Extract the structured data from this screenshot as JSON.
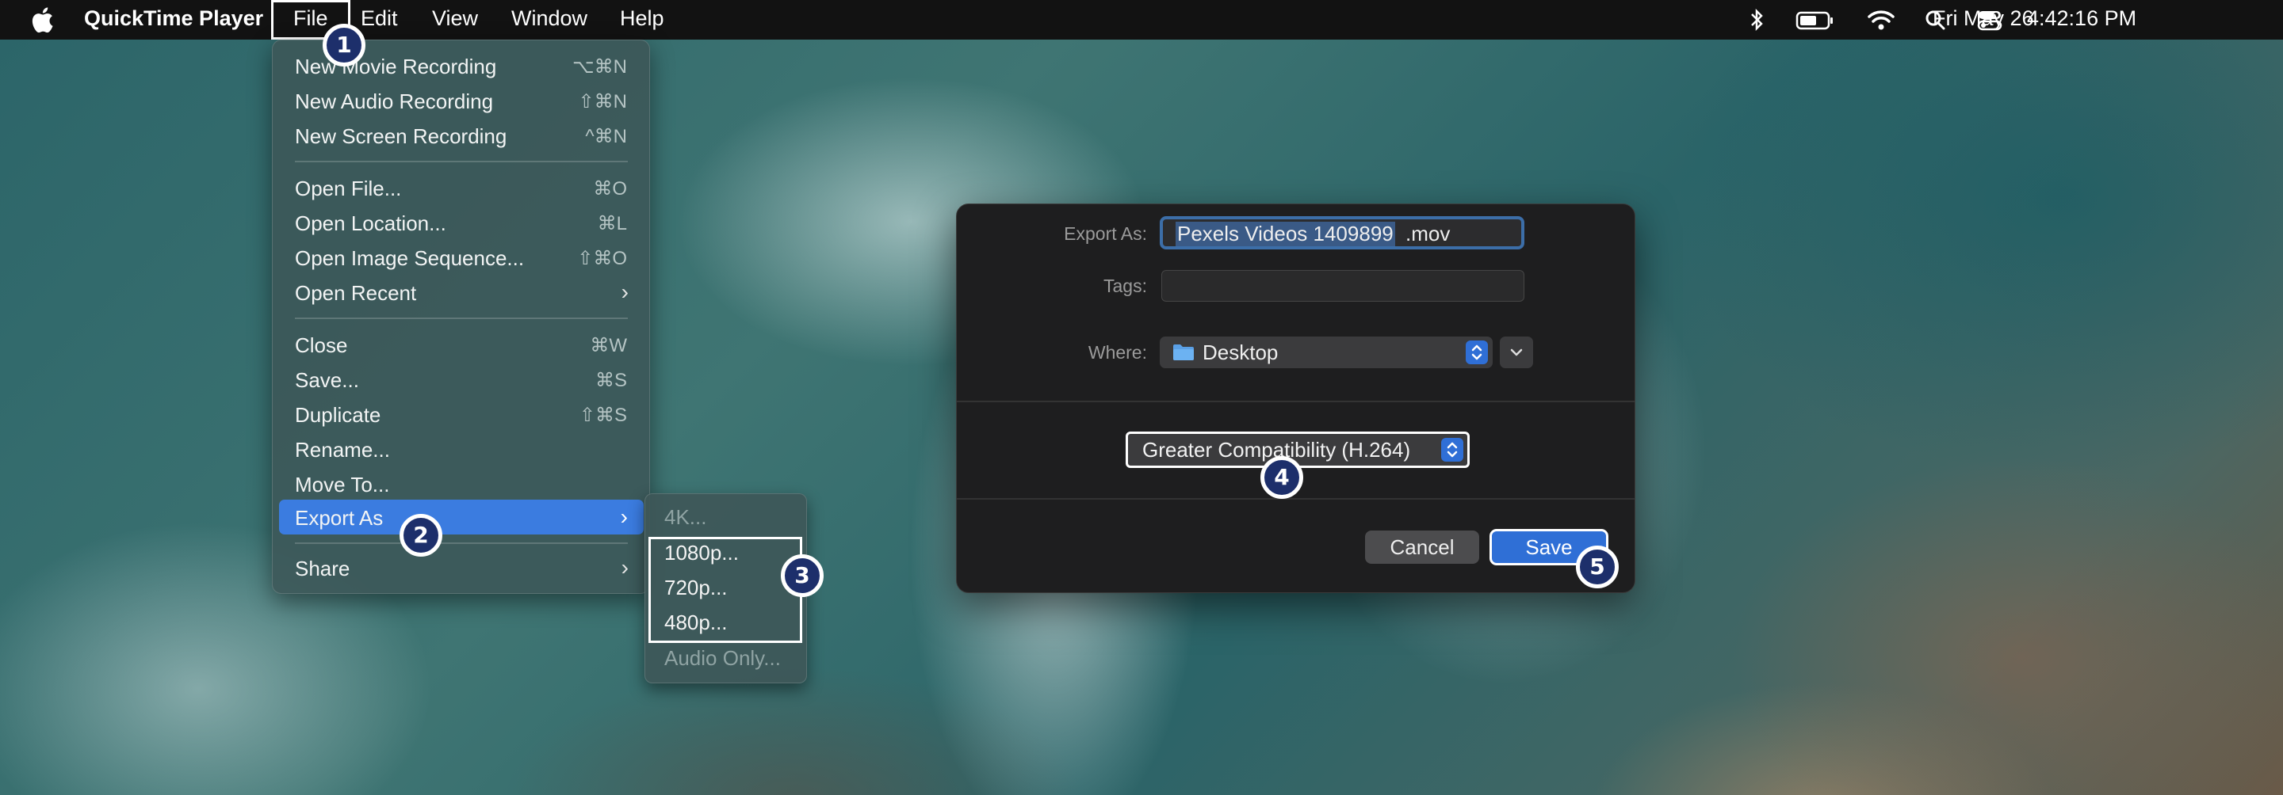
{
  "menubar": {
    "app_name": "QuickTime Player",
    "menus": [
      "File",
      "Edit",
      "View",
      "Window",
      "Help"
    ],
    "date": "Fri May 26",
    "time": "4:42:16 PM"
  },
  "file_menu": {
    "items": [
      {
        "label": "New Movie Recording",
        "shortcut": "⌥⌘N"
      },
      {
        "label": "New Audio Recording",
        "shortcut": "⇧⌘N"
      },
      {
        "label": "New Screen Recording",
        "shortcut": "^⌘N"
      },
      {
        "label": "Open File...",
        "shortcut": "⌘O"
      },
      {
        "label": "Open Location...",
        "shortcut": "⌘L"
      },
      {
        "label": "Open Image Sequence...",
        "shortcut": "⇧⌘O"
      },
      {
        "label": "Open Recent",
        "shortcut": ""
      },
      {
        "label": "Close",
        "shortcut": "⌘W"
      },
      {
        "label": "Save...",
        "shortcut": "⌘S"
      },
      {
        "label": "Duplicate",
        "shortcut": "⇧⌘S"
      },
      {
        "label": "Rename...",
        "shortcut": ""
      },
      {
        "label": "Move To...",
        "shortcut": ""
      },
      {
        "label": "Export As",
        "shortcut": ""
      },
      {
        "label": "Share",
        "shortcut": ""
      }
    ]
  },
  "export_submenu": {
    "items": [
      "4K...",
      "1080p...",
      "720p...",
      "480p...",
      "Audio Only..."
    ]
  },
  "dialog": {
    "export_as_label": "Export As:",
    "filename_selected": "Pexels Videos 1409899",
    "filename_ext": ".mov",
    "tags_label": "Tags:",
    "where_label": "Where:",
    "where_value": "Desktop",
    "format_value": "Greater Compatibility (H.264)",
    "cancel_label": "Cancel",
    "save_label": "Save"
  },
  "badges": [
    "1",
    "2",
    "3",
    "4",
    "5"
  ],
  "colors": {
    "accent": "#2f6fd6",
    "menu_highlight": "#3b7ce0",
    "badge_fill": "#1d2f6b"
  }
}
